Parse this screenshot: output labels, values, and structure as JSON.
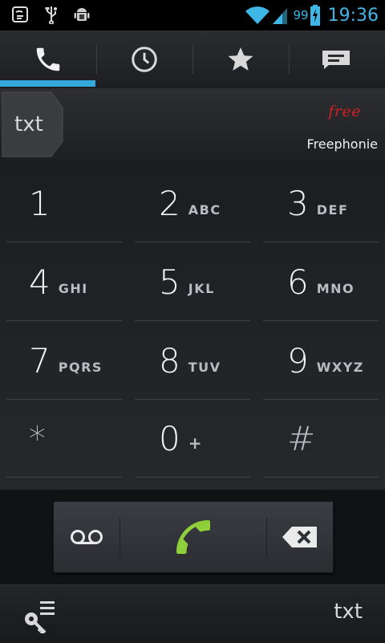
{
  "status_bar": {
    "icons": [
      "voicemail-contact-icon",
      "usb-icon",
      "android-debug-icon"
    ],
    "signal_icons": [
      "wifi-icon",
      "cell-signal-icon"
    ],
    "battery_percent": "99",
    "time": "19:36"
  },
  "tabs": [
    {
      "name": "phone-tab",
      "icon": "phone-icon",
      "selected": true
    },
    {
      "name": "recent-tab",
      "icon": "clock-icon",
      "selected": false
    },
    {
      "name": "favorites-tab",
      "icon": "star-icon",
      "selected": false
    },
    {
      "name": "messages-tab",
      "icon": "message-icon",
      "selected": false
    }
  ],
  "account": {
    "chip_label": "txt",
    "logo_text": "free",
    "carrier": "Freephonie"
  },
  "keypad": {
    "keys": [
      {
        "digit": "1",
        "letters": ""
      },
      {
        "digit": "2",
        "letters": "ABC"
      },
      {
        "digit": "3",
        "letters": "DEF"
      },
      {
        "digit": "4",
        "letters": "GHI"
      },
      {
        "digit": "5",
        "letters": "JKL"
      },
      {
        "digit": "6",
        "letters": "MNO"
      },
      {
        "digit": "7",
        "letters": "PQRS"
      },
      {
        "digit": "8",
        "letters": "TUV"
      },
      {
        "digit": "9",
        "letters": "WXYZ"
      },
      {
        "digit": "*",
        "letters": ""
      },
      {
        "digit": "0",
        "letters": "+"
      },
      {
        "digit": "#",
        "letters": ""
      }
    ]
  },
  "actions": {
    "voicemail_icon": "voicemail-icon",
    "call_icon": "call-icon",
    "backspace_icon": "backspace-icon",
    "call_color": "#8fcf3c"
  },
  "bottom_bar": {
    "menu_icon": "key-list-icon",
    "label": "txt"
  },
  "colors": {
    "accent": "#35a8db",
    "status_text": "#3fb7e6",
    "logo_red": "#d3201f"
  }
}
